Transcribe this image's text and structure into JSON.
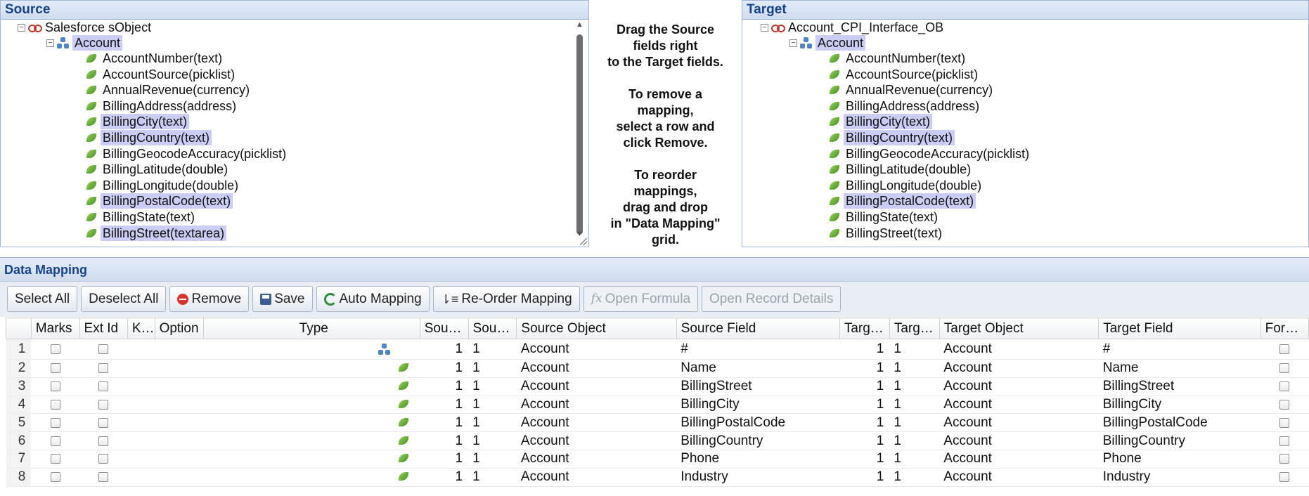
{
  "source": {
    "title": "Source",
    "root_label": "Salesforce sObject",
    "object_label": "Account",
    "fields": [
      {
        "label": "AccountNumber(text)",
        "selected": false
      },
      {
        "label": "AccountSource(picklist)",
        "selected": false
      },
      {
        "label": "AnnualRevenue(currency)",
        "selected": false
      },
      {
        "label": "BillingAddress(address)",
        "selected": false
      },
      {
        "label": "BillingCity(text)",
        "selected": true
      },
      {
        "label": "BillingCountry(text)",
        "selected": true
      },
      {
        "label": "BillingGeocodeAccuracy(picklist)",
        "selected": false
      },
      {
        "label": "BillingLatitude(double)",
        "selected": false
      },
      {
        "label": "BillingLongitude(double)",
        "selected": false
      },
      {
        "label": "BillingPostalCode(text)",
        "selected": true
      },
      {
        "label": "BillingState(text)",
        "selected": false
      },
      {
        "label": "BillingStreet(textarea)",
        "selected": true
      }
    ]
  },
  "target": {
    "title": "Target",
    "root_label": "Account_CPI_Interface_OB",
    "object_label": "Account",
    "fields": [
      {
        "label": "AccountNumber(text)",
        "selected": false
      },
      {
        "label": "AccountSource(picklist)",
        "selected": false
      },
      {
        "label": "AnnualRevenue(currency)",
        "selected": false
      },
      {
        "label": "BillingAddress(address)",
        "selected": false
      },
      {
        "label": "BillingCity(text)",
        "selected": true
      },
      {
        "label": "BillingCountry(text)",
        "selected": true
      },
      {
        "label": "BillingGeocodeAccuracy(picklist)",
        "selected": false
      },
      {
        "label": "BillingLatitude(double)",
        "selected": false
      },
      {
        "label": "BillingLongitude(double)",
        "selected": false
      },
      {
        "label": "BillingPostalCode(text)",
        "selected": true
      },
      {
        "label": "BillingState(text)",
        "selected": false
      },
      {
        "label": "BillingStreet(text)",
        "selected": false
      }
    ]
  },
  "instructions": {
    "p1": "Drag the Source\nfields right\nto the Target fields.",
    "p2": "To remove a\nmapping,\nselect a row and\nclick Remove.",
    "p3": "To reorder\nmappings,\ndrag and drop\nin \"Data Mapping\"\ngrid."
  },
  "mapping": {
    "title": "Data Mapping",
    "toolbar": {
      "select_all": "Select All",
      "deselect_all": "Deselect All",
      "remove": "Remove",
      "save": "Save",
      "auto_mapping": "Auto Mapping",
      "reorder": "Re-Order Mapping",
      "open_formula": "Open Formula",
      "open_record_details": "Open Record Details"
    },
    "columns": [
      "",
      "Marks",
      "Ext Id",
      "K…",
      "Option",
      "Type",
      "Sou…",
      "Sou…",
      "Source Object",
      "Source Field",
      "Targ…",
      "Targ…",
      "Target Object",
      "Target Field",
      "For…"
    ],
    "rows": [
      {
        "num": "1",
        "type": "object",
        "s1": "1",
        "s2": "1",
        "source_object": "Account",
        "source_field": "#",
        "t1": "1",
        "t2": "1",
        "target_object": "Account",
        "target_field": "#"
      },
      {
        "num": "2",
        "type": "field",
        "s1": "1",
        "s2": "1",
        "source_object": "Account",
        "source_field": "Name",
        "t1": "1",
        "t2": "1",
        "target_object": "Account",
        "target_field": "Name"
      },
      {
        "num": "3",
        "type": "field",
        "s1": "1",
        "s2": "1",
        "source_object": "Account",
        "source_field": "BillingStreet",
        "t1": "1",
        "t2": "1",
        "target_object": "Account",
        "target_field": "BillingStreet"
      },
      {
        "num": "4",
        "type": "field",
        "s1": "1",
        "s2": "1",
        "source_object": "Account",
        "source_field": "BillingCity",
        "t1": "1",
        "t2": "1",
        "target_object": "Account",
        "target_field": "BillingCity"
      },
      {
        "num": "5",
        "type": "field",
        "s1": "1",
        "s2": "1",
        "source_object": "Account",
        "source_field": "BillingPostalCode",
        "t1": "1",
        "t2": "1",
        "target_object": "Account",
        "target_field": "BillingPostalCode"
      },
      {
        "num": "6",
        "type": "field",
        "s1": "1",
        "s2": "1",
        "source_object": "Account",
        "source_field": "BillingCountry",
        "t1": "1",
        "t2": "1",
        "target_object": "Account",
        "target_field": "BillingCountry"
      },
      {
        "num": "7",
        "type": "field",
        "s1": "1",
        "s2": "1",
        "source_object": "Account",
        "source_field": "Phone",
        "t1": "1",
        "t2": "1",
        "target_object": "Account",
        "target_field": "Phone"
      },
      {
        "num": "8",
        "type": "field",
        "s1": "1",
        "s2": "1",
        "source_object": "Account",
        "source_field": "Industry",
        "t1": "1",
        "t2": "1",
        "target_object": "Account",
        "target_field": "Industry"
      }
    ]
  }
}
